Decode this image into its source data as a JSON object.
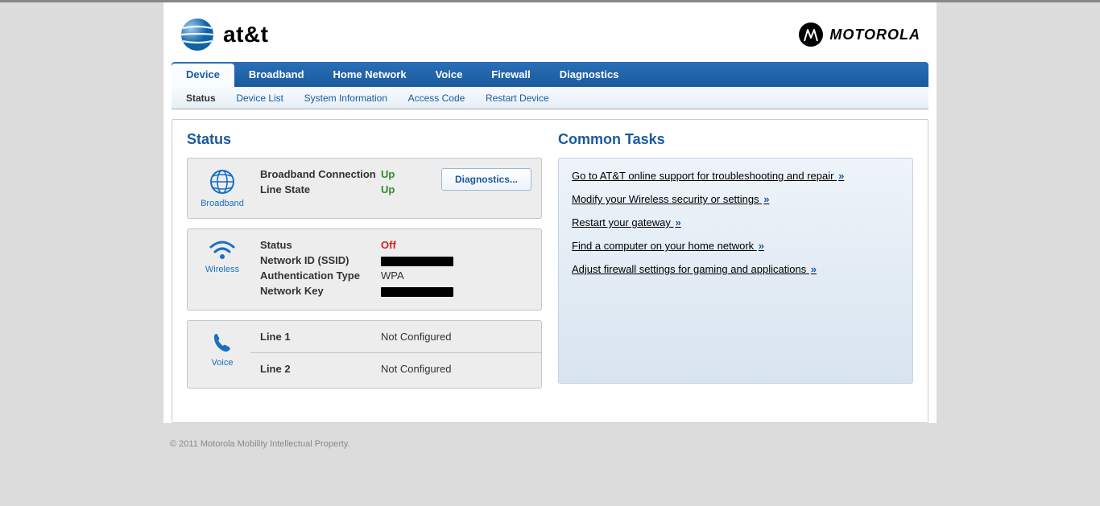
{
  "brand": {
    "att_text": "at&t",
    "moto_text": "MOTOROLA"
  },
  "topnav": {
    "items": [
      {
        "label": "Device",
        "active": true
      },
      {
        "label": "Broadband"
      },
      {
        "label": "Home Network"
      },
      {
        "label": "Voice"
      },
      {
        "label": "Firewall"
      },
      {
        "label": "Diagnostics"
      }
    ]
  },
  "subnav": {
    "items": [
      {
        "label": "Status",
        "active": true
      },
      {
        "label": "Device List"
      },
      {
        "label": "System Information"
      },
      {
        "label": "Access Code"
      },
      {
        "label": "Restart Device"
      }
    ]
  },
  "status": {
    "heading": "Status",
    "diag_button": "Diagnostics...",
    "broadband": {
      "title": "Broadband",
      "conn_label": "Broadband Connection",
      "conn_value": "Up",
      "line_label": "Line State",
      "line_value": "Up"
    },
    "wireless": {
      "title": "Wireless",
      "status_label": "Status",
      "status_value": "Off",
      "ssid_label": "Network ID (SSID)",
      "ssid_value": "█████████",
      "auth_label": "Authentication Type",
      "auth_value": "WPA",
      "key_label": "Network Key",
      "key_value": "█████████"
    },
    "voice": {
      "title": "Voice",
      "line1_label": "Line 1",
      "line1_value": "Not Configured",
      "line2_label": "Line 2",
      "line2_value": "Not Configured"
    }
  },
  "tasks": {
    "heading": "Common Tasks",
    "items": [
      "Go to AT&T online support for troubleshooting and repair",
      "Modify your Wireless security or settings",
      "Restart your gateway",
      "Find a computer on your home network",
      "Adjust firewall settings for gaming and applications"
    ]
  },
  "footer": "© 2011 Motorola Mobility Intellectual Property."
}
